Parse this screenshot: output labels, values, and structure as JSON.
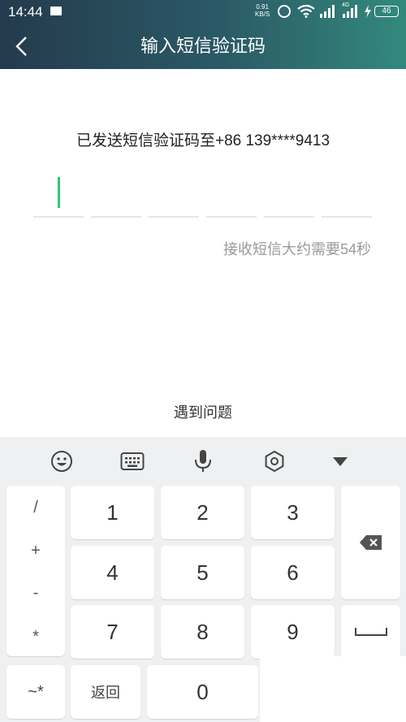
{
  "status_bar": {
    "time": "14:44",
    "net_speed_value": "0.91",
    "net_speed_unit": "KB/S",
    "network_label": "4G",
    "battery": "46"
  },
  "header": {
    "back_icon": "chevron-left-icon",
    "title": "输入短信验证码"
  },
  "verification": {
    "sent_message": "已发送短信验证码至+86 139****9413",
    "code_length": 6,
    "countdown": "接收短信大约需要54秒",
    "help_link": "遇到问题"
  },
  "keyboard": {
    "toolbar_icons": [
      "emoji-icon",
      "keyboard-icon",
      "microphone-icon",
      "settings-icon",
      "collapse-icon"
    ],
    "symbols": [
      "/",
      "+",
      "-",
      "*"
    ],
    "digits": [
      "1",
      "2",
      "3",
      "4",
      "5",
      "6",
      "7",
      "8",
      "9",
      "0"
    ],
    "switch_label": "~*",
    "return_label": "返回",
    "backspace_icon": "backspace-icon",
    "space_icon": "space-icon"
  },
  "colors": {
    "header_gradient_start": "#243a4d",
    "header_gradient_end": "#33897d",
    "cursor": "#2ec77a",
    "keyboard_bg": "#eef0f2"
  }
}
